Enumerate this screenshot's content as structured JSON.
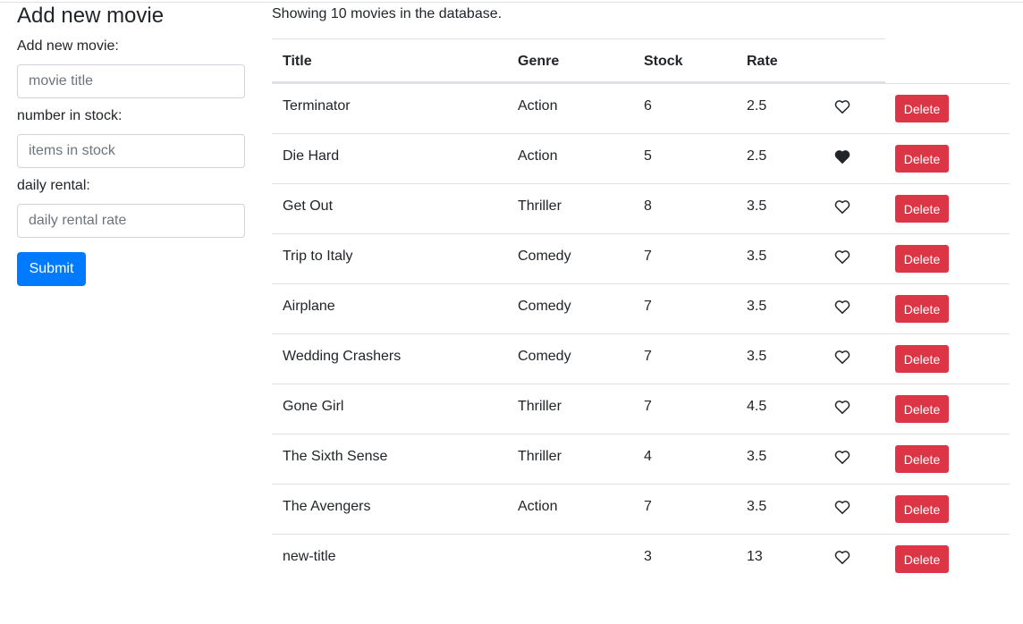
{
  "sidebar": {
    "heading": "Add new movie",
    "title_label": "Add new movie:",
    "title_placeholder": "movie title",
    "stock_label": "number in stock:",
    "stock_placeholder": "items in stock",
    "rate_label": "daily rental:",
    "rate_placeholder": "daily rental rate",
    "submit_label": "Submit"
  },
  "main": {
    "summary": "Showing 10 movies in the database.",
    "columns": [
      "Title",
      "Genre",
      "Stock",
      "Rate"
    ],
    "delete_label": "Delete",
    "rows": [
      {
        "title": "Terminator",
        "genre": "Action",
        "stock": "6",
        "rate": "2.5",
        "liked": false
      },
      {
        "title": "Die Hard",
        "genre": "Action",
        "stock": "5",
        "rate": "2.5",
        "liked": true
      },
      {
        "title": "Get Out",
        "genre": "Thriller",
        "stock": "8",
        "rate": "3.5",
        "liked": false
      },
      {
        "title": "Trip to Italy",
        "genre": "Comedy",
        "stock": "7",
        "rate": "3.5",
        "liked": false
      },
      {
        "title": "Airplane",
        "genre": "Comedy",
        "stock": "7",
        "rate": "3.5",
        "liked": false
      },
      {
        "title": "Wedding Crashers",
        "genre": "Comedy",
        "stock": "7",
        "rate": "3.5",
        "liked": false
      },
      {
        "title": "Gone Girl",
        "genre": "Thriller",
        "stock": "7",
        "rate": "4.5",
        "liked": false
      },
      {
        "title": "The Sixth Sense",
        "genre": "Thriller",
        "stock": "4",
        "rate": "3.5",
        "liked": false
      },
      {
        "title": "The Avengers",
        "genre": "Action",
        "stock": "7",
        "rate": "3.5",
        "liked": false
      },
      {
        "title": "new-title",
        "genre": "",
        "stock": "3",
        "rate": "13",
        "liked": false
      }
    ]
  },
  "colors": {
    "primary": "#007bff",
    "danger": "#dc3545",
    "text": "#212529",
    "border": "#dee2e6"
  }
}
